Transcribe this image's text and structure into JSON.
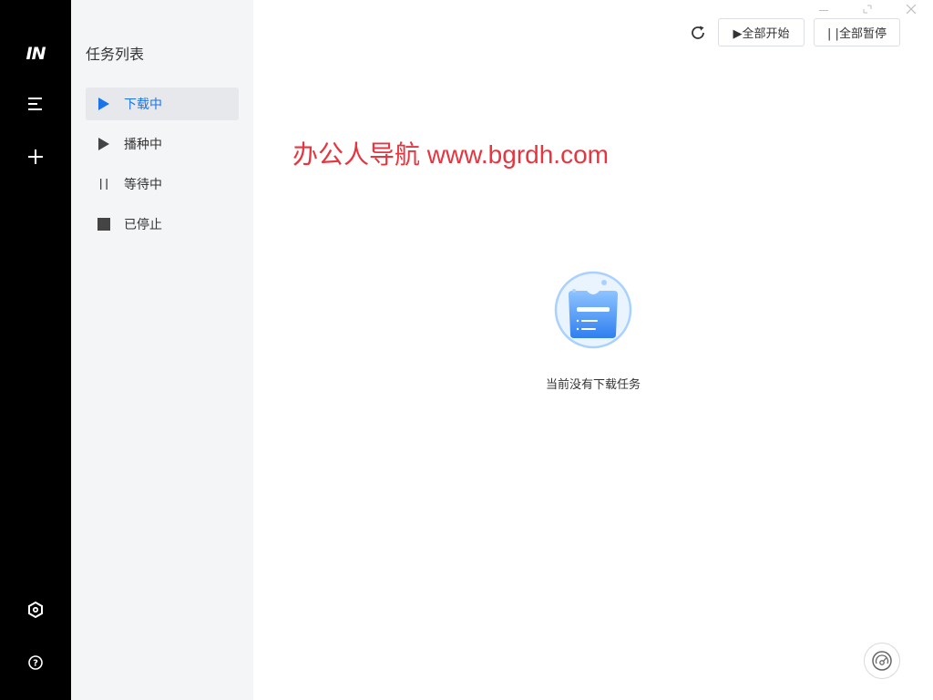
{
  "rail": {
    "logo_text": "IN",
    "icons": {
      "menu": "menu-icon",
      "add": "plus-icon",
      "settings": "settings-hexagon-icon",
      "help": "help-icon"
    }
  },
  "sidebar": {
    "title": "任务列表",
    "items": [
      {
        "label": "下载中",
        "icon": "play-icon",
        "active": true
      },
      {
        "label": "播种中",
        "icon": "play-icon",
        "active": false
      },
      {
        "label": "等待中",
        "icon": "pause-icon",
        "active": false
      },
      {
        "label": "已停止",
        "icon": "stop-icon",
        "active": false
      }
    ]
  },
  "toolbar": {
    "start_all_label": "▶全部开始",
    "pause_all_label": "| |全部暂停"
  },
  "watermark": "办公人导航 www.bgrdh.com",
  "empty_state": {
    "message": "当前没有下载任务"
  },
  "colors": {
    "rail_bg": "#000000",
    "sidebar_bg": "#f4f5f7",
    "accent": "#1a73e8",
    "watermark": "#e8343e"
  }
}
